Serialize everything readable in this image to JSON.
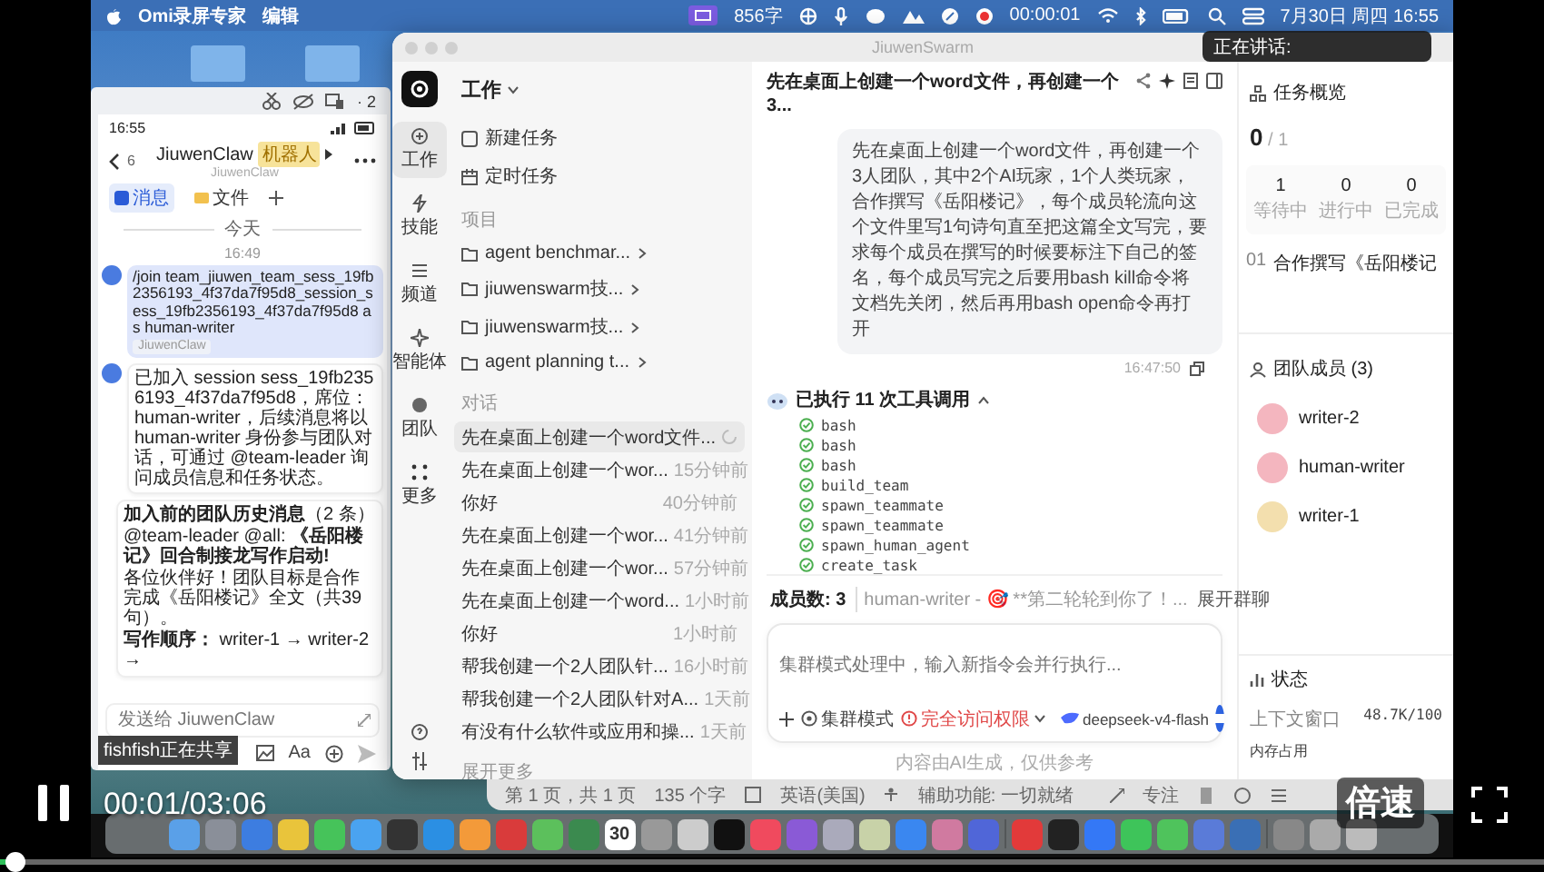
{
  "player": {
    "time": "00:01/03:06",
    "speed_button": "倍速",
    "progress": {
      "level": 0.006
    }
  },
  "menubar": {
    "app_name": "Omi录屏专家",
    "menus": [
      "编辑"
    ],
    "word_count": "856字",
    "record_time": "00:00:01",
    "datetime": "7月30日 周四 16:55"
  },
  "speaking_popup": "正在讲话:",
  "phone": {
    "toolbar_count": "· 2",
    "status_time": "16:55",
    "back_count": "6",
    "title": "JiuwenClaw",
    "badge": "机器人",
    "subtitle": "JiuwenClaw",
    "tabs": [
      {
        "label": "消息",
        "selected": true
      },
      {
        "label": "文件",
        "selected": false
      }
    ],
    "date_divider": "今天",
    "time": "16:49",
    "messages": [
      {
        "kind": "user",
        "text": "/join team_jiuwen_team_sess_19fb2356193_4f37da7f95d8_session_sess_19fb2356193_4f37da7f95d8 as human-writer",
        "tag": "JiuwenClaw"
      },
      {
        "kind": "bot",
        "text": "已加入 session sess_19fb2356193_4f37da7f95d8，席位：human-writer，后续消息将以 human-writer 身份参与团队对话，可通过 @team-leader 询问成员信息和任务状态。"
      },
      {
        "kind": "card",
        "lines": [
          "**加入前的团队历史消息**（2 条）",
          "@team-leader @all: **《岳阳楼记》回合制接龙写作启动!**",
          "各位伙伴好！团队目标是合作完成《岳阳楼记》全文（共39句）。",
          "**写作顺序：** writer-1 → writer-2 →"
        ]
      }
    ],
    "input": {
      "placeholder": "发送给 JiuwenClaw"
    },
    "format_button": "Aa",
    "sharing_label": "fishfish正在共享"
  },
  "app": {
    "title": "JiuwenSwarm",
    "rail": [
      {
        "label": "工作",
        "selected": true
      },
      {
        "label": "技能",
        "selected": false
      },
      {
        "label": "频道",
        "selected": false
      },
      {
        "label": "智能体",
        "selected": false
      },
      {
        "label": "团队",
        "selected": false
      },
      {
        "label": "更多",
        "selected": false
      }
    ],
    "sidebar": {
      "workspace": "工作",
      "actions": [
        "新建任务",
        "定时任务"
      ],
      "projects_label": "项目",
      "projects": [
        "agent benchmar...",
        "jiuwenswarm技...",
        "jiuwenswarm技...",
        "agent planning t..."
      ],
      "conversations_label": "对话",
      "conversations": [
        {
          "title": "先在桌面上创建一个word文件...",
          "selected": true,
          "running": true
        },
        {
          "title": "先在桌面上创建一个wor...",
          "time": "15分钟前",
          "selected": false,
          "running": false
        },
        {
          "title": "你好",
          "time": "40分钟前",
          "selected": false,
          "running": false
        },
        {
          "title": "先在桌面上创建一个wor...",
          "time": "41分钟前",
          "selected": false,
          "running": false
        },
        {
          "title": "先在桌面上创建一个wor...",
          "time": "57分钟前",
          "selected": false,
          "running": false
        },
        {
          "title": "先在桌面上创建一个word...",
          "time": "1小时前",
          "selected": false,
          "running": false
        },
        {
          "title": "你好",
          "time": "1小时前",
          "selected": false,
          "running": false
        },
        {
          "title": "帮我创建一个2人团队针...",
          "time": "16小时前",
          "selected": false,
          "running": false
        },
        {
          "title": "帮我创建一个2人团队针对A...",
          "time": "1天前",
          "selected": false,
          "running": false
        },
        {
          "title": "有没有什么软件或应用和操...",
          "time": "1天前",
          "selected": false,
          "running": false
        }
      ],
      "show_more": "展开更多"
    },
    "chat": {
      "title": "先在桌面上创建一个word文件，再创建一个3...",
      "user_message": "先在桌面上创建一个word文件，再创建一个3人团队，其中2个AI玩家，1个人类玩家，合作撰写《岳阳楼记》，每个成员轮流向这个文件里写1句诗句直至把这篇全文写完，要求每个成员在撰写的时候要标注下自己的签名，每个成员写完之后要用bash kill命令将文档先关闭，然后再用bash open命令再打开",
      "message_time": "16:47:50",
      "tools_header": "已执行 11 次工具调用",
      "tools": [
        "bash",
        "bash",
        "bash",
        "build_team",
        "spawn_teammate",
        "spawn_teammate",
        "spawn_human_agent",
        "create_task"
      ],
      "members_label": "成员数: 3",
      "members_preview": "human-writer - 🎯 **第二轮轮到你了！...",
      "expand_chat": "展开群聊",
      "input_placeholder": "集群模式处理中，输入新指令会并行执行...",
      "mode_button": "集群模式",
      "access_button": "完全访问权限",
      "model": "deepseek-v4-flash",
      "disclaimer": "内容由AI生成，仅供参考"
    },
    "tasks": {
      "title": "任务概览",
      "done": "0",
      "total": "/ 1",
      "stats": [
        {
          "value": "1",
          "label": "等待中"
        },
        {
          "value": "0",
          "label": "进行中"
        },
        {
          "value": "0",
          "label": "已完成"
        }
      ],
      "items": [
        {
          "number": "01",
          "title": "合作撰写《岳阳楼记"
        }
      ]
    },
    "team": {
      "title": "团队成员 (3)",
      "members": [
        {
          "name": "writer-2",
          "color": "#f4b6bf"
        },
        {
          "name": "human-writer",
          "color": "#f4b6bf"
        },
        {
          "name": "writer-1",
          "color": "#f3dfae"
        }
      ]
    },
    "status": {
      "title": "状态",
      "rows": [
        {
          "label": "上下文窗口",
          "value": "48.7K/100"
        },
        {
          "label": "内存占用"
        }
      ]
    }
  },
  "word_statusbar": [
    "第 1 页，共 1 页",
    "135 个字",
    "英语(美国)",
    "辅助功能: 一切就绪",
    "专注"
  ],
  "dock": {
    "calendar_day": "30"
  }
}
